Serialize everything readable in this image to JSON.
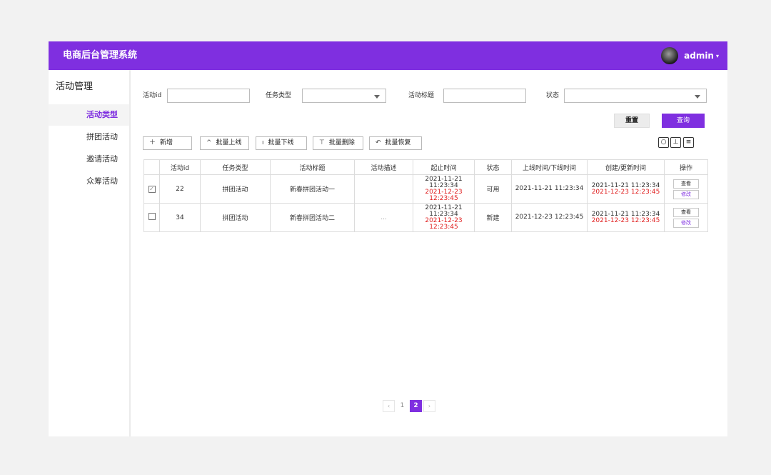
{
  "header": {
    "title": "电商后台管理系统",
    "username": "admin"
  },
  "sidebar": {
    "heading": "活动管理",
    "items": [
      {
        "label": "活动类型",
        "active": true
      },
      {
        "label": "拼团活动",
        "active": false
      },
      {
        "label": "邀请活动",
        "active": false
      },
      {
        "label": "众筹活动",
        "active": false
      }
    ]
  },
  "filters": {
    "activity_id_label": "活动id",
    "activity_id_value": "",
    "task_type_label": "任务类型",
    "task_type_value": "",
    "activity_title_label": "活动标题",
    "activity_title_value": "",
    "status_label": "状态",
    "status_value": "",
    "reset_label": "重置",
    "query_label": "查询"
  },
  "toolbar": {
    "add_label": "新增",
    "batch_online_label": "批量上线",
    "batch_offline_label": "批量下线",
    "batch_delete_label": "批量删除",
    "batch_restore_label": "批量恢复"
  },
  "table": {
    "columns": [
      "活动id",
      "任务类型",
      "活动标题",
      "活动描述",
      "起止时间",
      "状态",
      "上线时间/下线时间",
      "创建/更新时间",
      "操作"
    ],
    "rows": [
      {
        "checked": true,
        "id": "22",
        "task_type": "拼团活动",
        "title": "新春拼团活动一",
        "description": "",
        "start_time": "2021-11-21 11:23:34",
        "end_time": "2021-12-23 12:23:45",
        "status": "可用",
        "online_offline_time": "2021-11-21 11:23:34",
        "created_time": "2021-11-21 11:23:34",
        "updated_time": "2021-12-23 12:23:45",
        "view_label": "查看",
        "edit_label": "修改"
      },
      {
        "checked": false,
        "id": "34",
        "task_type": "拼团活动",
        "title": "新春拼团活动二",
        "description": "...",
        "start_time": "2021-11-21 11:23:34",
        "end_time": "2021-12-23 12:23:45",
        "status": "新建",
        "online_offline_time": "2021-12-23 12:23:45",
        "created_time": "2021-11-21 11:23:34",
        "updated_time": "2021-12-23 12:23:45",
        "view_label": "查看",
        "edit_label": "修改"
      }
    ]
  },
  "pagination": {
    "prev": "‹",
    "pages": [
      "1",
      "2"
    ],
    "current": "2",
    "next": "›"
  },
  "icons": {
    "add": "plus-icon",
    "online": "chevron-up-icon",
    "offline": "bar-icon",
    "delete": "trash-icon",
    "restore": "restore-icon",
    "refresh": "refresh-icon",
    "export": "export-icon",
    "columns": "columns-icon"
  },
  "colors": {
    "accent": "#7f2fe0",
    "alert": "#e02020"
  }
}
